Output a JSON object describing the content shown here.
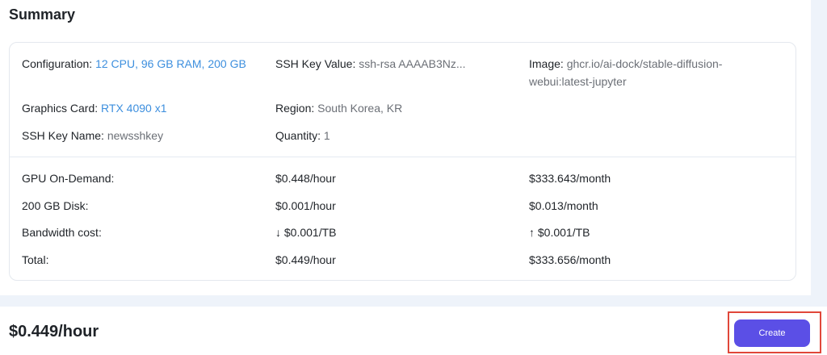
{
  "summary": {
    "title": "Summary",
    "configuration": {
      "label": "Configuration:",
      "value": "12 CPU, 96 GB RAM, 200 GB"
    },
    "ssh_key_value": {
      "label": "SSH Key Value:",
      "value": "ssh-rsa AAAAB3Nz..."
    },
    "image": {
      "label": "Image:",
      "value_line1": "ghcr.io/ai-dock/stable-diffusion-",
      "value_line2": "webui:latest-jupyter"
    },
    "graphics_card": {
      "label": "Graphics Card:",
      "value": "RTX 4090 x1"
    },
    "region": {
      "label": "Region:",
      "value": "South Korea, KR"
    },
    "ssh_key_name": {
      "label": "SSH Key Name:",
      "value": "newsshkey"
    },
    "quantity": {
      "label": "Quantity:",
      "value": "1"
    }
  },
  "costs": {
    "rows": [
      {
        "label": "GPU On-Demand:",
        "hourly": "$0.448/hour",
        "monthly": "$333.643/month"
      },
      {
        "label": "200 GB Disk:",
        "hourly": "$0.001/hour",
        "monthly": "$0.013/month"
      },
      {
        "label": "Bandwidth cost:",
        "hourly": "↓ $0.001/TB",
        "monthly": "↑ $0.001/TB"
      },
      {
        "label": "Total:",
        "hourly": "$0.449/hour",
        "monthly": "$333.656/month"
      }
    ]
  },
  "footer": {
    "price": "$0.449/hour",
    "create_label": "Create"
  },
  "colors": {
    "link": "#3d8fde",
    "muted": "#6b6f76",
    "primary_button": "#5b4fe6",
    "highlight_border": "#e0473a",
    "panel_bg": "#eef3fa"
  }
}
